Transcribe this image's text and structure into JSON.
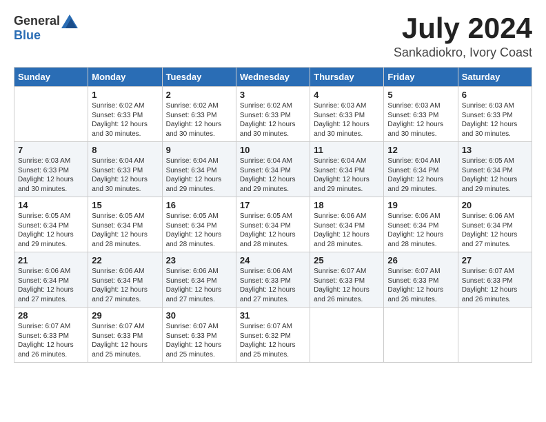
{
  "header": {
    "logo_general": "General",
    "logo_blue": "Blue",
    "month": "July 2024",
    "location": "Sankadiokro, Ivory Coast"
  },
  "days_of_week": [
    "Sunday",
    "Monday",
    "Tuesday",
    "Wednesday",
    "Thursday",
    "Friday",
    "Saturday"
  ],
  "weeks": [
    {
      "shade": "white",
      "cells": [
        {
          "day": "",
          "info": ""
        },
        {
          "day": "1",
          "info": "Sunrise: 6:02 AM\nSunset: 6:33 PM\nDaylight: 12 hours\nand 30 minutes."
        },
        {
          "day": "2",
          "info": "Sunrise: 6:02 AM\nSunset: 6:33 PM\nDaylight: 12 hours\nand 30 minutes."
        },
        {
          "day": "3",
          "info": "Sunrise: 6:02 AM\nSunset: 6:33 PM\nDaylight: 12 hours\nand 30 minutes."
        },
        {
          "day": "4",
          "info": "Sunrise: 6:03 AM\nSunset: 6:33 PM\nDaylight: 12 hours\nand 30 minutes."
        },
        {
          "day": "5",
          "info": "Sunrise: 6:03 AM\nSunset: 6:33 PM\nDaylight: 12 hours\nand 30 minutes."
        },
        {
          "day": "6",
          "info": "Sunrise: 6:03 AM\nSunset: 6:33 PM\nDaylight: 12 hours\nand 30 minutes."
        }
      ]
    },
    {
      "shade": "shade",
      "cells": [
        {
          "day": "7",
          "info": "Sunrise: 6:03 AM\nSunset: 6:33 PM\nDaylight: 12 hours\nand 30 minutes."
        },
        {
          "day": "8",
          "info": "Sunrise: 6:04 AM\nSunset: 6:33 PM\nDaylight: 12 hours\nand 30 minutes."
        },
        {
          "day": "9",
          "info": "Sunrise: 6:04 AM\nSunset: 6:34 PM\nDaylight: 12 hours\nand 29 minutes."
        },
        {
          "day": "10",
          "info": "Sunrise: 6:04 AM\nSunset: 6:34 PM\nDaylight: 12 hours\nand 29 minutes."
        },
        {
          "day": "11",
          "info": "Sunrise: 6:04 AM\nSunset: 6:34 PM\nDaylight: 12 hours\nand 29 minutes."
        },
        {
          "day": "12",
          "info": "Sunrise: 6:04 AM\nSunset: 6:34 PM\nDaylight: 12 hours\nand 29 minutes."
        },
        {
          "day": "13",
          "info": "Sunrise: 6:05 AM\nSunset: 6:34 PM\nDaylight: 12 hours\nand 29 minutes."
        }
      ]
    },
    {
      "shade": "white",
      "cells": [
        {
          "day": "14",
          "info": "Sunrise: 6:05 AM\nSunset: 6:34 PM\nDaylight: 12 hours\nand 29 minutes."
        },
        {
          "day": "15",
          "info": "Sunrise: 6:05 AM\nSunset: 6:34 PM\nDaylight: 12 hours\nand 28 minutes."
        },
        {
          "day": "16",
          "info": "Sunrise: 6:05 AM\nSunset: 6:34 PM\nDaylight: 12 hours\nand 28 minutes."
        },
        {
          "day": "17",
          "info": "Sunrise: 6:05 AM\nSunset: 6:34 PM\nDaylight: 12 hours\nand 28 minutes."
        },
        {
          "day": "18",
          "info": "Sunrise: 6:06 AM\nSunset: 6:34 PM\nDaylight: 12 hours\nand 28 minutes."
        },
        {
          "day": "19",
          "info": "Sunrise: 6:06 AM\nSunset: 6:34 PM\nDaylight: 12 hours\nand 28 minutes."
        },
        {
          "day": "20",
          "info": "Sunrise: 6:06 AM\nSunset: 6:34 PM\nDaylight: 12 hours\nand 27 minutes."
        }
      ]
    },
    {
      "shade": "shade",
      "cells": [
        {
          "day": "21",
          "info": "Sunrise: 6:06 AM\nSunset: 6:34 PM\nDaylight: 12 hours\nand 27 minutes."
        },
        {
          "day": "22",
          "info": "Sunrise: 6:06 AM\nSunset: 6:34 PM\nDaylight: 12 hours\nand 27 minutes."
        },
        {
          "day": "23",
          "info": "Sunrise: 6:06 AM\nSunset: 6:34 PM\nDaylight: 12 hours\nand 27 minutes."
        },
        {
          "day": "24",
          "info": "Sunrise: 6:06 AM\nSunset: 6:33 PM\nDaylight: 12 hours\nand 27 minutes."
        },
        {
          "day": "25",
          "info": "Sunrise: 6:07 AM\nSunset: 6:33 PM\nDaylight: 12 hours\nand 26 minutes."
        },
        {
          "day": "26",
          "info": "Sunrise: 6:07 AM\nSunset: 6:33 PM\nDaylight: 12 hours\nand 26 minutes."
        },
        {
          "day": "27",
          "info": "Sunrise: 6:07 AM\nSunset: 6:33 PM\nDaylight: 12 hours\nand 26 minutes."
        }
      ]
    },
    {
      "shade": "white",
      "cells": [
        {
          "day": "28",
          "info": "Sunrise: 6:07 AM\nSunset: 6:33 PM\nDaylight: 12 hours\nand 26 minutes."
        },
        {
          "day": "29",
          "info": "Sunrise: 6:07 AM\nSunset: 6:33 PM\nDaylight: 12 hours\nand 25 minutes."
        },
        {
          "day": "30",
          "info": "Sunrise: 6:07 AM\nSunset: 6:33 PM\nDaylight: 12 hours\nand 25 minutes."
        },
        {
          "day": "31",
          "info": "Sunrise: 6:07 AM\nSunset: 6:32 PM\nDaylight: 12 hours\nand 25 minutes."
        },
        {
          "day": "",
          "info": ""
        },
        {
          "day": "",
          "info": ""
        },
        {
          "day": "",
          "info": ""
        }
      ]
    }
  ]
}
